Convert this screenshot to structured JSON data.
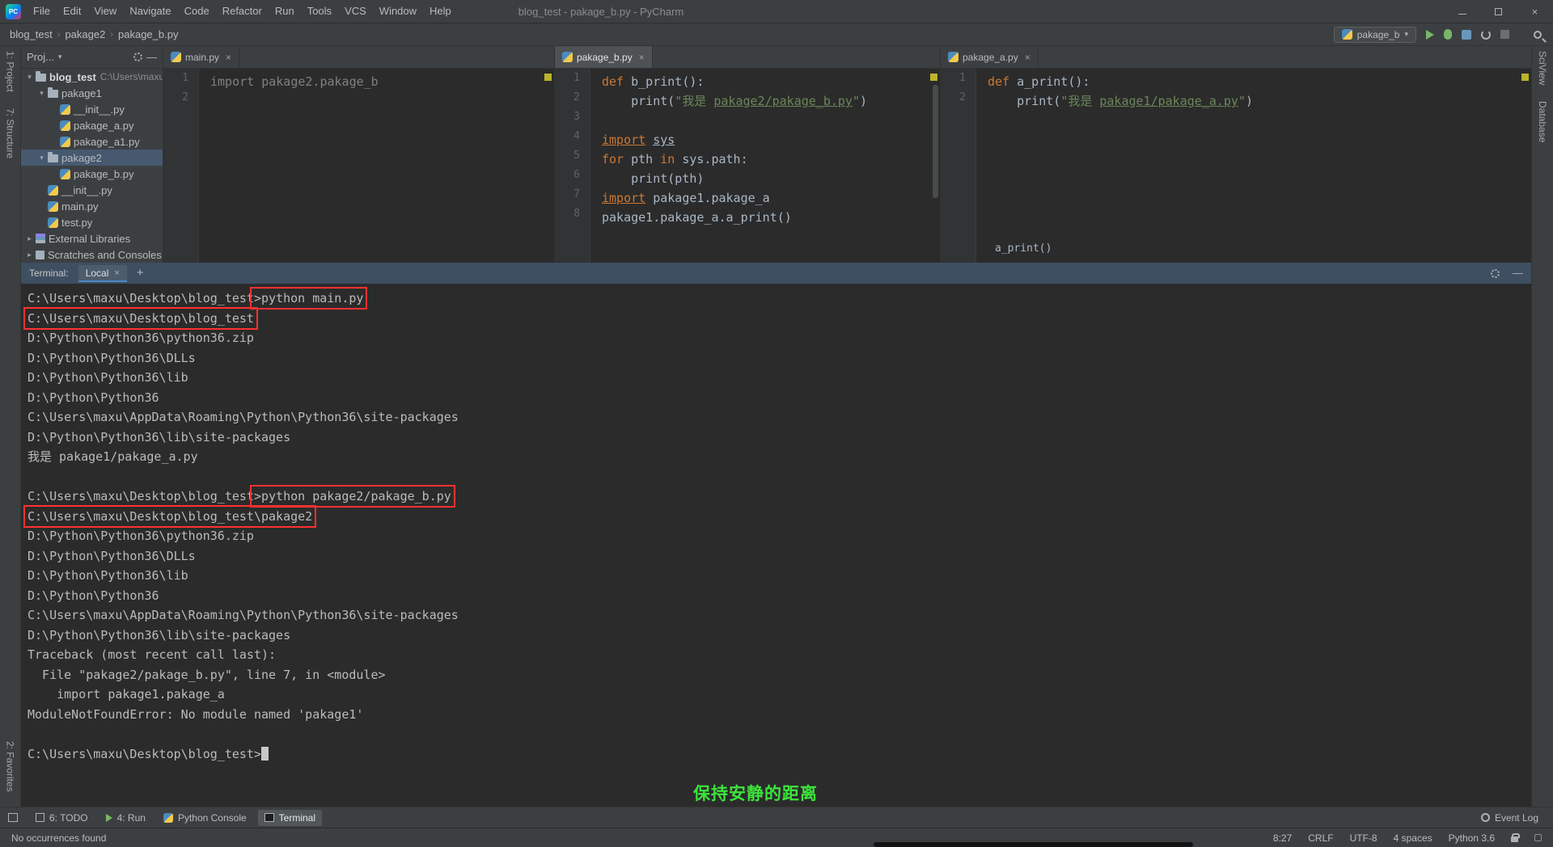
{
  "colors": {
    "annotation_red": "#FF3030",
    "annotation_green": "#3CE43C",
    "accent_blue": "#4A88C7",
    "keyword_orange": "#CC7832",
    "string_green": "#6A8759"
  },
  "window": {
    "menus": [
      "File",
      "Edit",
      "View",
      "Navigate",
      "Code",
      "Refactor",
      "Run",
      "Tools",
      "VCS",
      "Window",
      "Help"
    ],
    "title": "blog_test - pakage_b.py - PyCharm"
  },
  "breadcrumbs": [
    "blog_test",
    "pakage2",
    "pakage_b.py"
  ],
  "run_widget": {
    "config": "pakage_b"
  },
  "stripes": {
    "left_top": [
      "1: Project",
      "7: Structure"
    ],
    "left_bottom": [
      "2: Favorites"
    ],
    "right": [
      "SciView",
      "Database"
    ]
  },
  "project": {
    "header": "Proj...",
    "tree": [
      {
        "label": "blog_test",
        "hint": "C:\\Users\\maxu",
        "level": 0,
        "icon": "folder",
        "arrow": "down",
        "bold": true
      },
      {
        "label": "pakage1",
        "level": 1,
        "icon": "folder",
        "arrow": "down"
      },
      {
        "label": "__init__.py",
        "level": 2,
        "icon": "python"
      },
      {
        "label": "pakage_a.py",
        "level": 2,
        "icon": "python"
      },
      {
        "label": "pakage_a1.py",
        "level": 2,
        "icon": "python"
      },
      {
        "label": "pakage2",
        "level": 1,
        "icon": "folder",
        "arrow": "down",
        "selected": true
      },
      {
        "label": "pakage_b.py",
        "level": 2,
        "icon": "python"
      },
      {
        "label": "__init__.py",
        "level": 1,
        "icon": "python"
      },
      {
        "label": "main.py",
        "level": 1,
        "icon": "python"
      },
      {
        "label": "test.py",
        "level": 1,
        "icon": "python"
      },
      {
        "label": "External Libraries",
        "level": 0,
        "icon": "library",
        "arrow": "right"
      },
      {
        "label": "Scratches and Consoles",
        "level": 0,
        "icon": "scratch",
        "arrow": "right"
      }
    ]
  },
  "editors": [
    {
      "tab": "main.py",
      "active": false,
      "lines": [
        [
          {
            "t": "import pakage2.pakage_b",
            "c": "g"
          }
        ],
        []
      ]
    },
    {
      "tab": "pakage_b.py",
      "active": true,
      "lines": [
        [
          {
            "t": "def ",
            "c": "k"
          },
          {
            "t": "b_print():",
            "c": "n"
          }
        ],
        [
          {
            "t": "    print(",
            "c": "n"
          },
          {
            "t": "\"我是 ",
            "c": "s"
          },
          {
            "t": "pakage2/pakage_b.py",
            "c": "s u"
          },
          {
            "t": "\"",
            "c": "s"
          },
          {
            "t": ")",
            "c": "n"
          }
        ],
        [],
        [
          {
            "t": "import",
            "c": "k u"
          },
          {
            "t": " ",
            "c": "n"
          },
          {
            "t": "sys",
            "c": "n u"
          }
        ],
        [
          {
            "t": "for ",
            "c": "k"
          },
          {
            "t": "pth ",
            "c": "n"
          },
          {
            "t": "in ",
            "c": "k"
          },
          {
            "t": "sys.path:",
            "c": "n"
          }
        ],
        [
          {
            "t": "    print(pth)",
            "c": "n"
          }
        ],
        [
          {
            "t": "import",
            "c": "k u"
          },
          {
            "t": " pakage1.pakage_a",
            "c": "n"
          }
        ],
        [
          {
            "t": "pakage1.pakage_a.a_print()",
            "c": "n"
          }
        ]
      ]
    },
    {
      "tab": "pakage_a.py",
      "active": false,
      "lines": [
        [
          {
            "t": "def ",
            "c": "k"
          },
          {
            "t": "a_print():",
            "c": "n"
          }
        ],
        [
          {
            "t": "    print(",
            "c": "n"
          },
          {
            "t": "\"我是 ",
            "c": "s"
          },
          {
            "t": "pakage1/pakage_a.py",
            "c": "s u"
          },
          {
            "t": "\"",
            "c": "s"
          },
          {
            "t": ")",
            "c": "n"
          }
        ]
      ]
    }
  ],
  "editor_hint": "a_print()",
  "terminal": {
    "label": "Terminal:",
    "tab": "Local",
    "add_button": "+",
    "lines": [
      [
        {
          "t": "C:\\Users\\maxu\\Desktop\\blog_test",
          "c": ""
        },
        {
          "t": ">python main.py",
          "c": "box"
        }
      ],
      [
        {
          "t": "C:\\Users\\maxu\\Desktop\\blog_test",
          "c": "box"
        }
      ],
      [
        {
          "t": "D:\\Python\\Python36\\python36.zip",
          "c": ""
        }
      ],
      [
        {
          "t": "D:\\Python\\Python36\\DLLs",
          "c": ""
        }
      ],
      [
        {
          "t": "D:\\Python\\Python36\\lib",
          "c": ""
        }
      ],
      [
        {
          "t": "D:\\Python\\Python36",
          "c": ""
        }
      ],
      [
        {
          "t": "C:\\Users\\maxu\\AppData\\Roaming\\Python\\Python36\\site-packages",
          "c": ""
        }
      ],
      [
        {
          "t": "D:\\Python\\Python36\\lib\\site-packages",
          "c": ""
        }
      ],
      [
        {
          "t": "我是 pakage1/pakage_a.py",
          "c": ""
        }
      ],
      [],
      [
        {
          "t": "C:\\Users\\maxu\\Desktop\\blog_test",
          "c": ""
        },
        {
          "t": ">python pakage2/pakage_b.py",
          "c": "box"
        }
      ],
      [
        {
          "t": "C:\\Users\\maxu\\Desktop\\blog_test\\pakage2",
          "c": "box"
        }
      ],
      [
        {
          "t": "D:\\Python\\Python36\\python36.zip",
          "c": ""
        }
      ],
      [
        {
          "t": "D:\\Python\\Python36\\DLLs",
          "c": ""
        }
      ],
      [
        {
          "t": "D:\\Python\\Python36\\lib",
          "c": ""
        }
      ],
      [
        {
          "t": "D:\\Python\\Python36",
          "c": ""
        }
      ],
      [
        {
          "t": "C:\\Users\\maxu\\AppData\\Roaming\\Python\\Python36\\site-packages",
          "c": ""
        }
      ],
      [
        {
          "t": "D:\\Python\\Python36\\lib\\site-packages",
          "c": ""
        }
      ],
      [
        {
          "t": "Traceback (most recent call last):",
          "c": ""
        }
      ],
      [
        {
          "t": "  File \"pakage2/pakage_b.py\", line 7, in <module>",
          "c": ""
        }
      ],
      [
        {
          "t": "    import pakage1.pakage_a",
          "c": ""
        }
      ],
      [
        {
          "t": "ModuleNotFoundError: No module named 'pakage1'",
          "c": ""
        }
      ],
      [],
      [
        {
          "t": "C:\\Users\\maxu\\Desktop\\blog_test>",
          "c": ""
        },
        {
          "t": "",
          "c": "cursor"
        }
      ]
    ]
  },
  "overlay": {
    "green_text": "保持安静的距离"
  },
  "tool_bar": {
    "items": [
      {
        "label": "6: TODO",
        "icon": "todo"
      },
      {
        "label": "4: Run",
        "icon": "run"
      },
      {
        "label": "Python Console",
        "icon": "python"
      },
      {
        "label": "Terminal",
        "icon": "terminal",
        "active": true
      }
    ],
    "right": "Event Log"
  },
  "status_bar": {
    "message": "No occurrences found",
    "items": [
      "8:27",
      "CRLF",
      "UTF-8",
      "4 spaces",
      "Python 3.6"
    ]
  }
}
